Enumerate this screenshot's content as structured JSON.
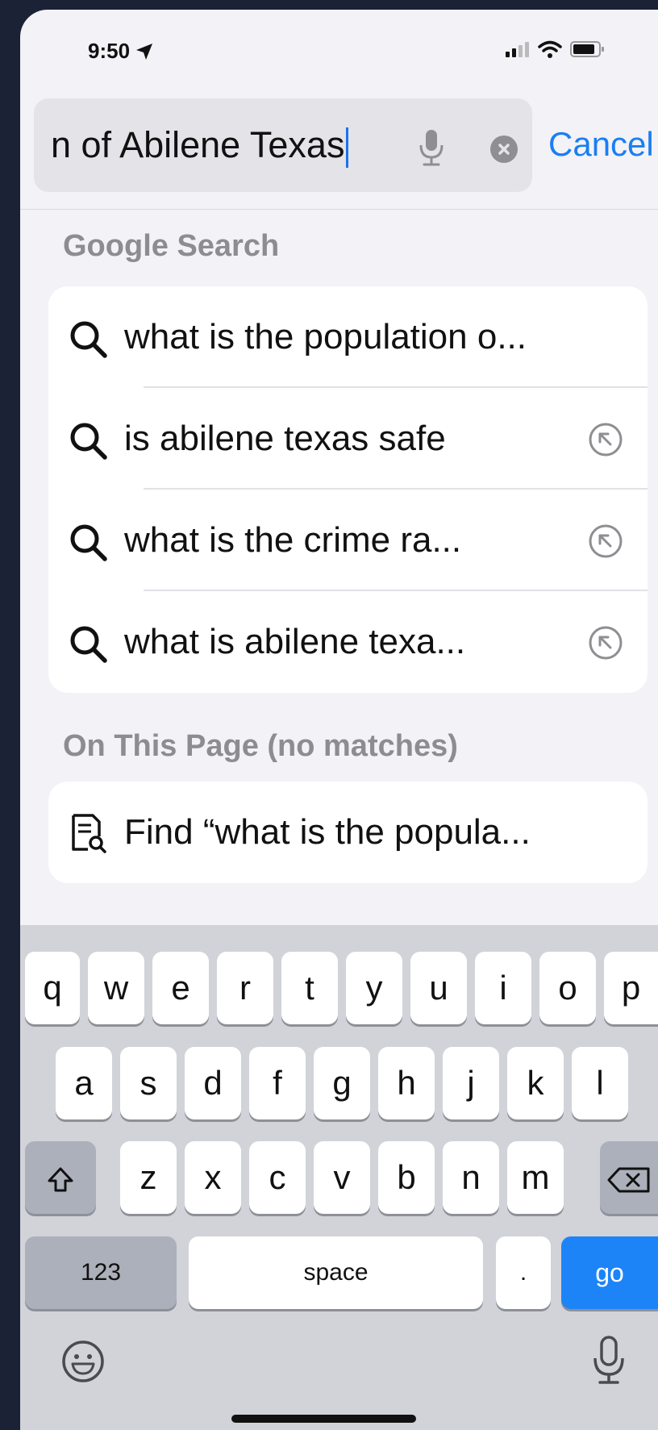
{
  "status_bar": {
    "time": "9:50"
  },
  "search": {
    "query_visible": "n of Abilene Texas",
    "cancel_label": "Cancel"
  },
  "sections": {
    "google_header": "Google Search",
    "page_header": "On This Page (no matches)"
  },
  "suggestions": [
    {
      "text": "what is the population o..."
    },
    {
      "text": "is abilene texas safe"
    },
    {
      "text": "what is the crime ra..."
    },
    {
      "text": "what is abilene texa..."
    }
  ],
  "find_on_page": {
    "text": "Find “what is the popula..."
  },
  "keyboard": {
    "row1": [
      "q",
      "w",
      "e",
      "r",
      "t",
      "y",
      "u",
      "i",
      "o",
      "p"
    ],
    "row2": [
      "a",
      "s",
      "d",
      "f",
      "g",
      "h",
      "j",
      "k",
      "l"
    ],
    "row3": [
      "z",
      "x",
      "c",
      "v",
      "b",
      "n",
      "m"
    ],
    "numbers_label": "123",
    "space_label": "space",
    "period_label": ".",
    "go_label": "go"
  },
  "colors": {
    "accent": "#1a7ef2",
    "go_key": "#1d84f7",
    "background": "#f2f2f7"
  }
}
